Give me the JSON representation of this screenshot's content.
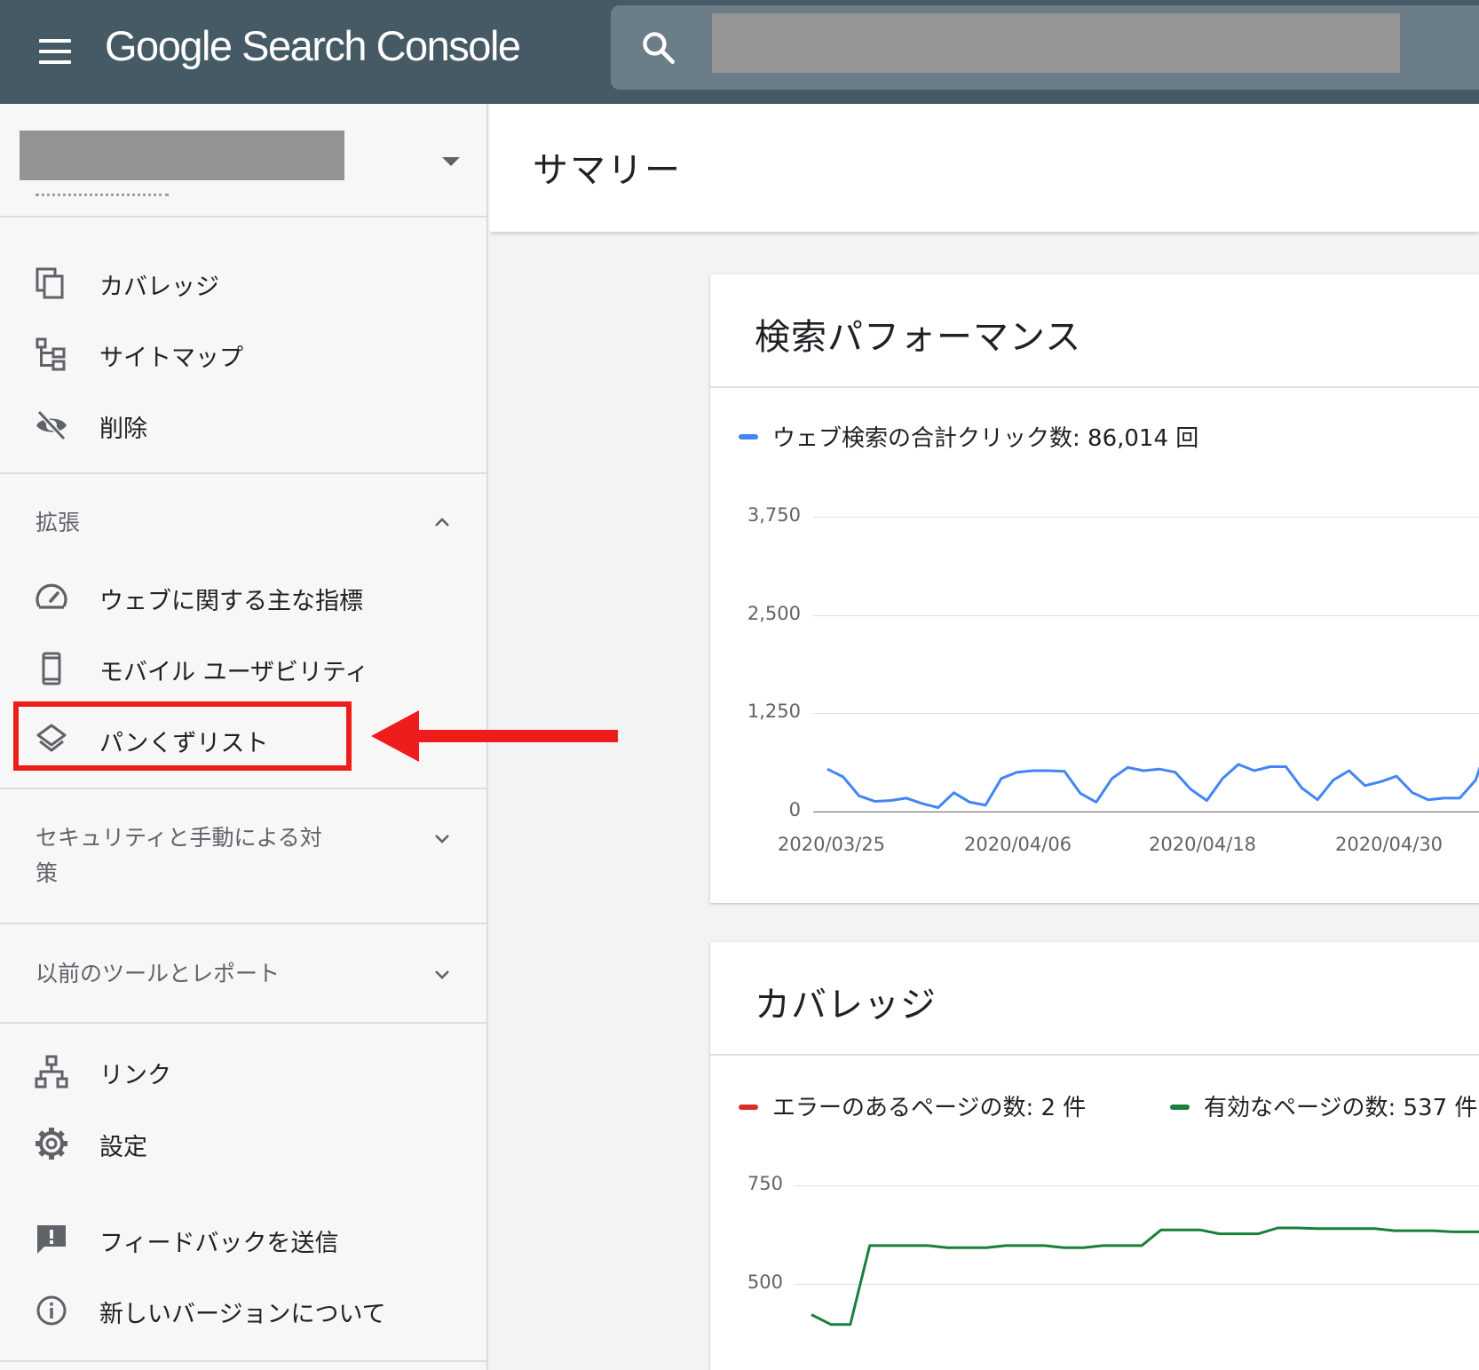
{
  "header": {
    "app_title": "Google Search Console",
    "menu_icon": "menu-icon",
    "search_icon": "search-icon"
  },
  "sidebar": {
    "top_items": [
      {
        "label": "カバレッジ",
        "icon": "coverage-icon"
      },
      {
        "label": "サイトマップ",
        "icon": "sitemap-icon"
      },
      {
        "label": "削除",
        "icon": "removals-icon"
      }
    ],
    "enhancements": {
      "header": "拡張",
      "items": [
        {
          "label": "ウェブに関する主な指標",
          "icon": "speed-icon"
        },
        {
          "label": "モバイル ユーザビリティ",
          "icon": "mobile-icon"
        },
        {
          "label": "パンくずリスト",
          "icon": "layers-icon"
        }
      ]
    },
    "security": {
      "header_line1": "セキュリティと手動による対",
      "header_line2": "策"
    },
    "legacy": {
      "header": "以前のツールとレポート"
    },
    "bottom_items": [
      {
        "label": "リンク",
        "icon": "links-icon"
      },
      {
        "label": "設定",
        "icon": "settings-icon"
      },
      {
        "label": "フィードバックを送信",
        "icon": "feedback-icon"
      },
      {
        "label": "新しいバージョンについて",
        "icon": "info-icon"
      }
    ]
  },
  "main": {
    "title": "サマリー",
    "performance_card": {
      "title": "検索パフォーマンス",
      "legend": "ウェブ検索の合計クリック数: 86,014 回"
    },
    "coverage_card": {
      "title": "カバレッジ",
      "legend_error": "エラーのあるページの数: 2 件",
      "legend_valid": "有効なページの数: 537 件"
    }
  },
  "colors": {
    "topbar": "#455a64",
    "clicks_line": "#4285f4",
    "error_line": "#d93025",
    "valid_line": "#188038",
    "annotation_red": "#ef1c1c"
  },
  "chart_data": [
    {
      "type": "line",
      "title": "検索パフォーマンス",
      "series": [
        {
          "name": "ウェブ検索の合計クリック数: 86,014 回",
          "values": [
            540,
            440,
            200,
            130,
            140,
            170,
            100,
            50,
            240,
            120,
            80,
            420,
            500,
            520,
            520,
            510,
            230,
            120,
            420,
            560,
            520,
            540,
            500,
            280,
            140,
            420,
            600,
            520,
            570,
            570,
            300,
            150,
            400,
            520,
            330,
            380,
            450,
            240,
            150,
            170,
            170,
            400,
            980
          ]
        }
      ],
      "x_ticks": [
        "2020/03/25",
        "2020/04/06",
        "2020/04/18",
        "2020/04/30"
      ],
      "y_ticks": [
        "0",
        "1,250",
        "2,500",
        "3,750"
      ],
      "ylim": [
        0,
        3750
      ],
      "grid": true,
      "legend_position": "top-left"
    },
    {
      "type": "line",
      "title": "カバレッジ",
      "series": [
        {
          "name": "有効なページの数: 537 件",
          "values": [
            422,
            397,
            397,
            597,
            597,
            597,
            597,
            592,
            592,
            592,
            597,
            597,
            597,
            592,
            592,
            597,
            597,
            597,
            637,
            637,
            637,
            627,
            627,
            627,
            642,
            642,
            640,
            640,
            640,
            640,
            635,
            635,
            635,
            632,
            632,
            632
          ]
        },
        {
          "name": "エラーのあるページの数: 2 件",
          "values": []
        }
      ],
      "y_ticks": [
        "500",
        "750"
      ],
      "grid": true,
      "legend_position": "top-left"
    }
  ]
}
